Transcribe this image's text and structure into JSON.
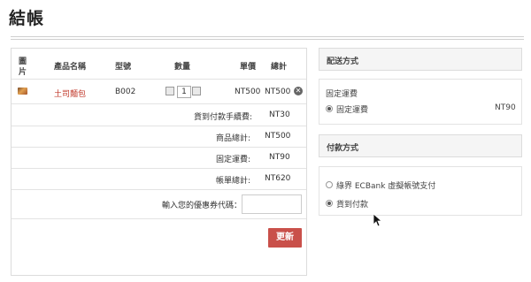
{
  "page": {
    "title": "結帳"
  },
  "cart": {
    "headers": {
      "image": "圖",
      "image2": "片",
      "name": "產品名稱",
      "model": "型號",
      "quantity": "數量",
      "unit_price": "單價",
      "total": "總計"
    },
    "item": {
      "name": "土司麵包",
      "model": "B002",
      "quantity": "1",
      "unit_price": "NT500",
      "total": "NT500"
    },
    "summary": [
      {
        "label": "貨到付款手續費:",
        "value": "NT30"
      },
      {
        "label": "商品總計:",
        "value": "NT500"
      },
      {
        "label": "固定運費:",
        "value": "NT90"
      },
      {
        "label": "帳單總計:",
        "value": "NT620"
      }
    ],
    "coupon_label": "輸入您的優惠券代碼：",
    "coupon_value": "",
    "update_label": "更新"
  },
  "shipping": {
    "heading": "配送方式",
    "group": "固定運費",
    "option_label": "固定運費",
    "option_price": "NT90"
  },
  "payment": {
    "heading": "付款方式",
    "options": [
      {
        "label": "綠界 ECBank 虛擬帳號支付",
        "selected": false
      },
      {
        "label": "貨到付款",
        "selected": true
      }
    ]
  },
  "colors": {
    "accent": "#c9504a",
    "product_link": "#c0392b"
  }
}
